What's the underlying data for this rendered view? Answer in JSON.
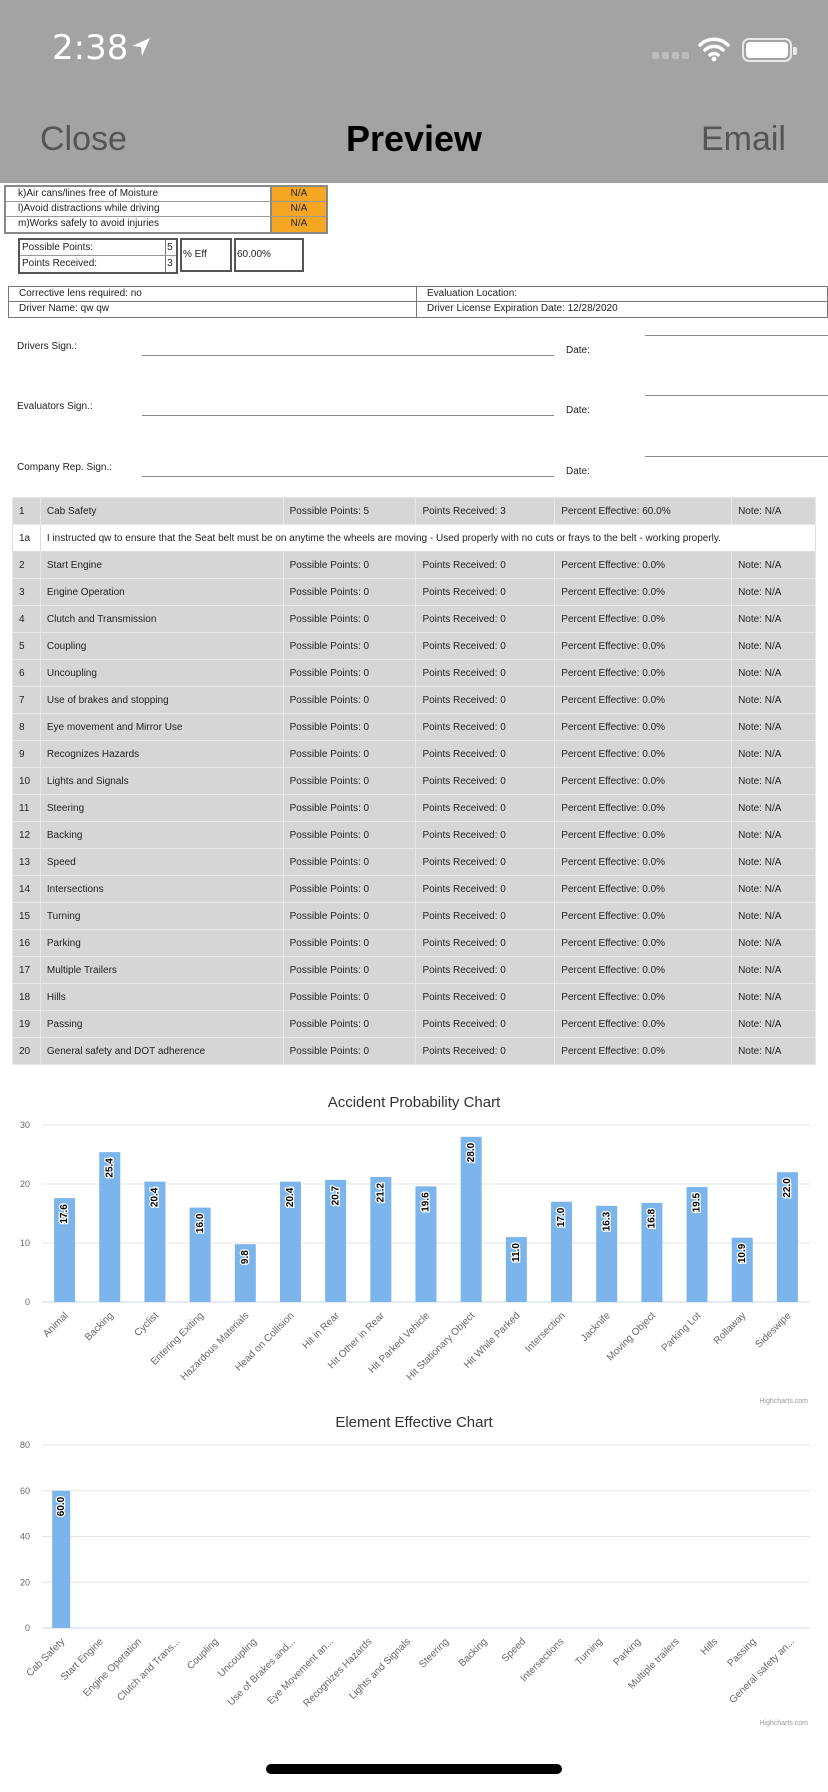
{
  "status_bar": {
    "time": "2:38"
  },
  "nav": {
    "close": "Close",
    "title": "Preview",
    "email": "Email"
  },
  "checklist": [
    {
      "label": "k)Air cans/lines free of Moisture",
      "value": "N/A"
    },
    {
      "label": "l)Avoid distractions while driving",
      "value": "N/A"
    },
    {
      "label": "m)Works safely to avoid injuries",
      "value": "N/A"
    }
  ],
  "points_summary": {
    "possible_label": "Possible Points:",
    "possible_value": "5",
    "received_label": "Points Received:",
    "received_value": "3",
    "eff_label": "% Eff",
    "eff_value": "60.00%"
  },
  "info": {
    "corrective_lens": "Corrective lens required: no",
    "evaluation_location": "Evaluation Location:",
    "driver_name": "Driver Name: qw qw",
    "license_expiration": "Driver License Expiration Date: 12/28/2020"
  },
  "signatures": {
    "driver": "Drivers Sign.:",
    "evaluator": "Evaluators Sign.:",
    "company": "Company Rep. Sign.:",
    "date": "Date:"
  },
  "evaluation": {
    "rows": [
      {
        "num": "1",
        "name": "Cab Safety",
        "possible": "Possible Points: 5",
        "received": "Points Received: 3",
        "pct": "Percent Effective: 60.0%",
        "note": "Note: N/A"
      },
      {
        "num": "2",
        "name": "Start Engine",
        "possible": "Possible Points: 0",
        "received": "Points Received: 0",
        "pct": "Percent Effective: 0.0%",
        "note": "Note: N/A"
      },
      {
        "num": "3",
        "name": "Engine Operation",
        "possible": "Possible Points: 0",
        "received": "Points Received: 0",
        "pct": "Percent Effective: 0.0%",
        "note": "Note: N/A"
      },
      {
        "num": "4",
        "name": "Clutch and Transmission",
        "possible": "Possible Points: 0",
        "received": "Points Received: 0",
        "pct": "Percent Effective: 0.0%",
        "note": "Note: N/A"
      },
      {
        "num": "5",
        "name": "Coupling",
        "possible": "Possible Points: 0",
        "received": "Points Received: 0",
        "pct": "Percent Effective: 0.0%",
        "note": "Note: N/A"
      },
      {
        "num": "6",
        "name": "Uncoupling",
        "possible": "Possible Points: 0",
        "received": "Points Received: 0",
        "pct": "Percent Effective: 0.0%",
        "note": "Note: N/A"
      },
      {
        "num": "7",
        "name": "Use of brakes and stopping",
        "possible": "Possible Points: 0",
        "received": "Points Received: 0",
        "pct": "Percent Effective: 0.0%",
        "note": "Note: N/A"
      },
      {
        "num": "8",
        "name": "Eye movement and Mirror Use",
        "possible": "Possible Points: 0",
        "received": "Points Received: 0",
        "pct": "Percent Effective: 0.0%",
        "note": "Note: N/A"
      },
      {
        "num": "9",
        "name": "Recognizes Hazards",
        "possible": "Possible Points: 0",
        "received": "Points Received: 0",
        "pct": "Percent Effective: 0.0%",
        "note": "Note: N/A"
      },
      {
        "num": "10",
        "name": "Lights and Signals",
        "possible": "Possible Points: 0",
        "received": "Points Received: 0",
        "pct": "Percent Effective: 0.0%",
        "note": "Note: N/A"
      },
      {
        "num": "11",
        "name": "Steering",
        "possible": "Possible Points: 0",
        "received": "Points Received: 0",
        "pct": "Percent Effective: 0.0%",
        "note": "Note: N/A"
      },
      {
        "num": "12",
        "name": "Backing",
        "possible": "Possible Points: 0",
        "received": "Points Received: 0",
        "pct": "Percent Effective: 0.0%",
        "note": "Note: N/A"
      },
      {
        "num": "13",
        "name": "Speed",
        "possible": "Possible Points: 0",
        "received": "Points Received: 0",
        "pct": "Percent Effective: 0.0%",
        "note": "Note: N/A"
      },
      {
        "num": "14",
        "name": "Intersections",
        "possible": "Possible Points: 0",
        "received": "Points Received: 0",
        "pct": "Percent Effective: 0.0%",
        "note": "Note: N/A"
      },
      {
        "num": "15",
        "name": "Turning",
        "possible": "Possible Points: 0",
        "received": "Points Received: 0",
        "pct": "Percent Effective: 0.0%",
        "note": "Note: N/A"
      },
      {
        "num": "16",
        "name": "Parking",
        "possible": "Possible Points: 0",
        "received": "Points Received: 0",
        "pct": "Percent Effective: 0.0%",
        "note": "Note: N/A"
      },
      {
        "num": "17",
        "name": "Multiple Trailers",
        "possible": "Possible Points: 0",
        "received": "Points Received: 0",
        "pct": "Percent Effective: 0.0%",
        "note": "Note: N/A"
      },
      {
        "num": "18",
        "name": "Hills",
        "possible": "Possible Points: 0",
        "received": "Points Received: 0",
        "pct": "Percent Effective: 0.0%",
        "note": "Note: N/A"
      },
      {
        "num": "19",
        "name": "Passing",
        "possible": "Possible Points: 0",
        "received": "Points Received: 0",
        "pct": "Percent Effective: 0.0%",
        "note": "Note: N/A"
      },
      {
        "num": "20",
        "name": "General safety and DOT adherence",
        "possible": "Possible Points: 0",
        "received": "Points Received: 0",
        "pct": "Percent Effective: 0.0%",
        "note": "Note: N/A"
      }
    ],
    "note_row": {
      "num": "1a",
      "text": "I instructed qw to ensure that the Seat belt must be on anytime the wheels are moving - Used properly with no cuts or frays to the belt - working properly."
    }
  },
  "chart_data": [
    {
      "type": "bar",
      "title": "Accident Probability Chart",
      "categories": [
        "Animal",
        "Backing",
        "Cyclist",
        "Entering Exiting",
        "Hazardous Materials",
        "Head on Collision",
        "Hit in Rear",
        "Hit Other in Rear",
        "Hit Parked Vehicle",
        "Hit Stationary Object",
        "Hit While Parked",
        "Intersection",
        "Jacknife",
        "Moving Object",
        "Parking Lot",
        "Rollaway",
        "Sideswipe"
      ],
      "values": [
        17.6,
        25.4,
        20.4,
        16.0,
        9.8,
        20.4,
        20.7,
        21.2,
        19.6,
        28.0,
        11.0,
        17.0,
        16.3,
        16.8,
        19.5,
        10.9,
        22.0
      ],
      "data_labels": [
        "17.6",
        "25.4",
        "20.4",
        "16.0",
        "9.8",
        "20.4",
        "20.7",
        "21.2",
        "19.6",
        "28.0",
        "11.0",
        "17.0",
        "16.3",
        "16.8",
        "19.5",
        "10.9",
        "22.0"
      ],
      "y_ticks": [
        "0",
        "10",
        "20",
        "30"
      ],
      "ylim": [
        0,
        30
      ],
      "color": "#7cb5ec",
      "credit": "Highcharts.com"
    },
    {
      "type": "bar",
      "title": "Element Effective Chart",
      "categories": [
        "Cab Safety",
        "Start Engine",
        "Engine Operation",
        "Clutch and Trans...",
        "Coupling",
        "Uncoupling",
        "Use of Brakes and...",
        "Eye Movement an...",
        "Recognizes Hazards",
        "Lights and Signals",
        "Steering",
        "Backing",
        "Speed",
        "Intersections",
        "Turning",
        "Parking",
        "Multiple trailers",
        "Hills",
        "Passing",
        "General safety an..."
      ],
      "values": [
        60.0,
        0,
        0,
        0,
        0,
        0,
        0,
        0,
        0,
        0,
        0,
        0,
        0,
        0,
        0,
        0,
        0,
        0,
        0,
        0
      ],
      "data_labels": [
        "60.0",
        "",
        "",
        "",
        "",
        "",
        "",
        "",
        "",
        "",
        "",
        "",
        "",
        "",
        "",
        "",
        "",
        "",
        "",
        ""
      ],
      "y_ticks": [
        "0",
        "20",
        "40",
        "60",
        "80"
      ],
      "ylim": [
        0,
        80
      ],
      "color": "#7cb5ec",
      "credit": "Highcharts.com"
    }
  ]
}
